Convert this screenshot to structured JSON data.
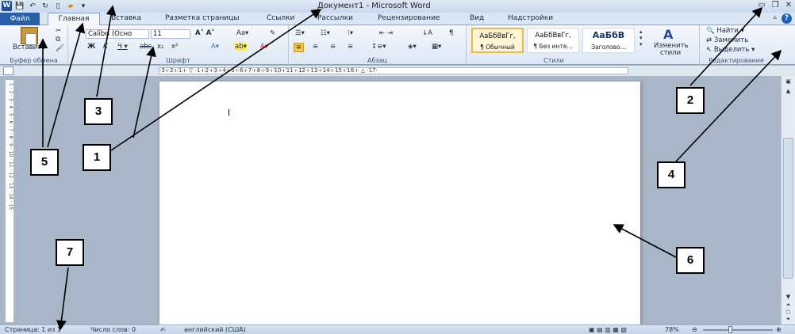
{
  "window": {
    "title": "Документ1  -  Microsoft Word"
  },
  "tabs": [
    "Файл",
    "Главная",
    "Вставка",
    "Разметка страницы",
    "Ссылки",
    "Рассылки",
    "Рецензирование",
    "Вид",
    "Надстройки"
  ],
  "clipboard": {
    "paste_label": "Вставить",
    "group_label": "Буфер обмена"
  },
  "font": {
    "name": "Calibri (Осно",
    "size": "11",
    "group_label": "Шрифт"
  },
  "paragraph": {
    "group_label": "Абзац"
  },
  "styles": {
    "items": [
      {
        "sample": "АаБбВвГг,",
        "name": "¶ Обычный"
      },
      {
        "sample": "АаБбВвГг,",
        "name": "¶ Без инте..."
      },
      {
        "sample": "АаБбВ",
        "name": "Заголово..."
      }
    ],
    "change_label": "Изменить",
    "change_label2": "стили",
    "group_label": "Стили"
  },
  "editing": {
    "find": "Найти",
    "replace": "Заменить",
    "select": "Выделить",
    "group_label": "Редактирование"
  },
  "ruler": {
    "h_text": "·3·ı·2·ı·1·ı· ▽ ·1·ı·2·ı·3·ı·4·ı·5·ı·6·ı·7·ı·8·ı·9·ı·10·ı·11·ı·12·ı·13·ı·14·ı·15·ı·16·ı· △ ·17·"
  },
  "status": {
    "page": "Страница: 1 из 1",
    "words": "Число слов: 0",
    "language": "английский (США)",
    "zoom": "78%"
  },
  "callouts": [
    "1",
    "2",
    "3",
    "4",
    "5",
    "6",
    "7"
  ]
}
